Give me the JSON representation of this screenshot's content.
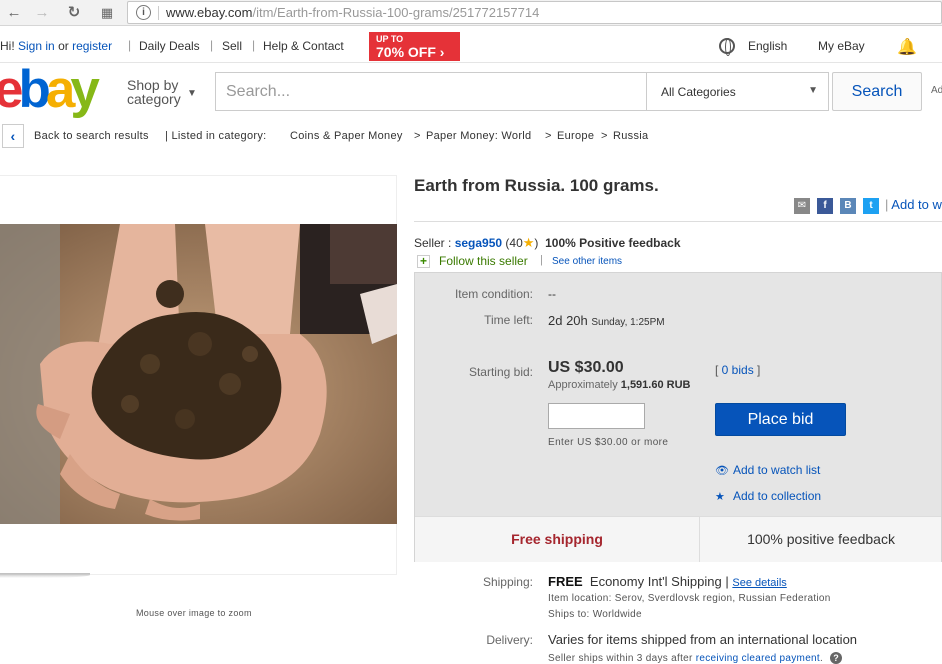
{
  "browser": {
    "url_host": "www.ebay.com",
    "url_path": "/itm/Earth-from-Russia-100-grams/251772157714"
  },
  "global_header": {
    "greeting": "Hi!",
    "sign_in": "Sign in",
    "or": "or",
    "register": "register",
    "daily_deals": "Daily Deals",
    "sell": "Sell",
    "help_contact": "Help & Contact",
    "promo_line1": "UP TO",
    "promo_line2": "70% OFF ›",
    "language": "English",
    "my_ebay": "My eBay"
  },
  "logo_letters": [
    "e",
    "b",
    "a",
    "y"
  ],
  "search": {
    "shop_by_line1": "Shop by",
    "shop_by_line2": "category",
    "placeholder": "Search...",
    "category": "All Categories",
    "button": "Search",
    "advanced_prefix": "Ad"
  },
  "breadcrumb": {
    "back": "Back to search results",
    "listed_in": "| Listed in category:",
    "path": [
      "Coins & Paper Money",
      "Paper Money: World",
      "Europe",
      "Russia"
    ],
    "sep": ">"
  },
  "image": {
    "zoom_hint": "Mouse over image to zoom"
  },
  "item": {
    "title": "Earth from Russia. 100 grams.",
    "add_to": "Add to w",
    "seller_label": "Seller :",
    "seller_name": "sega950",
    "feedback_count_open": "(40",
    "feedback_count_close": ")",
    "positive_feedback": "100% Positive feedback",
    "follow": "Follow this seller",
    "see_other": "See other items",
    "condition_label": "Item condition:",
    "condition_value": "--",
    "time_left_label": "Time left:",
    "time_left_value": "2d 20h",
    "time_left_when": "Sunday, 1:25PM",
    "starting_bid_label": "Starting bid:",
    "starting_bid_value": "US $30.00",
    "approx_prefix": "Approximately",
    "approx_value": "1,591.60 RUB",
    "bids": "0 bids",
    "enter_hint": "Enter US $30.00 or more",
    "place_bid": "Place bid",
    "watch_list": "Add to watch list",
    "collection": "Add to collection",
    "free_shipping": "Free shipping",
    "positive_strip": "100% positive feedback"
  },
  "shipping": {
    "label": "Shipping:",
    "free": "FREE",
    "method": "Economy Int'l Shipping |",
    "see_details": "See details",
    "location": "Item location:  Serov, Sverdlovsk region, Russian Federation",
    "ships_to": "Ships to:  Worldwide"
  },
  "delivery": {
    "label": "Delivery:",
    "value": "Varies for items shipped from an international location",
    "note_prefix": "Seller ships within 3 days after",
    "note_link": "receiving cleared payment",
    "note_suffix": "."
  },
  "colors": {
    "ebay_red": "#e53238",
    "ebay_blue": "#0064d2",
    "ebay_yellow": "#f5af02",
    "ebay_green": "#86b817",
    "link_blue": "#0654ba",
    "free_shipping_red": "#a5262e"
  }
}
